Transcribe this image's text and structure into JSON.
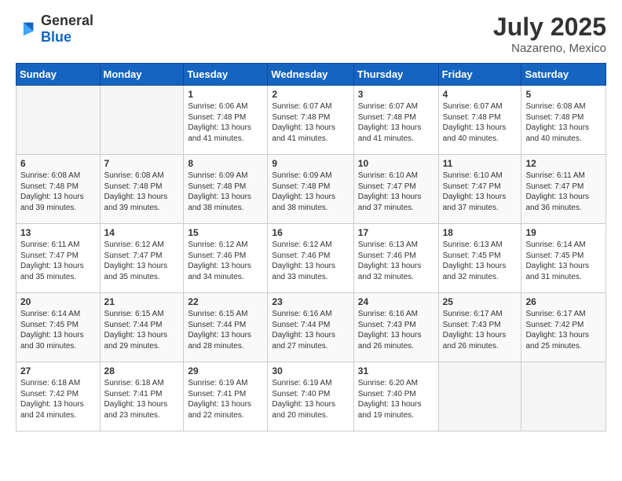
{
  "logo": {
    "general": "General",
    "blue": "Blue"
  },
  "header": {
    "month_year": "July 2025",
    "location": "Nazareno, Mexico"
  },
  "days_of_week": [
    "Sunday",
    "Monday",
    "Tuesday",
    "Wednesday",
    "Thursday",
    "Friday",
    "Saturday"
  ],
  "weeks": [
    [
      {
        "day": "",
        "info": ""
      },
      {
        "day": "",
        "info": ""
      },
      {
        "day": "1",
        "info": "Sunrise: 6:06 AM\nSunset: 7:48 PM\nDaylight: 13 hours and 41 minutes."
      },
      {
        "day": "2",
        "info": "Sunrise: 6:07 AM\nSunset: 7:48 PM\nDaylight: 13 hours and 41 minutes."
      },
      {
        "day": "3",
        "info": "Sunrise: 6:07 AM\nSunset: 7:48 PM\nDaylight: 13 hours and 41 minutes."
      },
      {
        "day": "4",
        "info": "Sunrise: 6:07 AM\nSunset: 7:48 PM\nDaylight: 13 hours and 40 minutes."
      },
      {
        "day": "5",
        "info": "Sunrise: 6:08 AM\nSunset: 7:48 PM\nDaylight: 13 hours and 40 minutes."
      }
    ],
    [
      {
        "day": "6",
        "info": "Sunrise: 6:08 AM\nSunset: 7:48 PM\nDaylight: 13 hours and 39 minutes."
      },
      {
        "day": "7",
        "info": "Sunrise: 6:08 AM\nSunset: 7:48 PM\nDaylight: 13 hours and 39 minutes."
      },
      {
        "day": "8",
        "info": "Sunrise: 6:09 AM\nSunset: 7:48 PM\nDaylight: 13 hours and 38 minutes."
      },
      {
        "day": "9",
        "info": "Sunrise: 6:09 AM\nSunset: 7:48 PM\nDaylight: 13 hours and 38 minutes."
      },
      {
        "day": "10",
        "info": "Sunrise: 6:10 AM\nSunset: 7:47 PM\nDaylight: 13 hours and 37 minutes."
      },
      {
        "day": "11",
        "info": "Sunrise: 6:10 AM\nSunset: 7:47 PM\nDaylight: 13 hours and 37 minutes."
      },
      {
        "day": "12",
        "info": "Sunrise: 6:11 AM\nSunset: 7:47 PM\nDaylight: 13 hours and 36 minutes."
      }
    ],
    [
      {
        "day": "13",
        "info": "Sunrise: 6:11 AM\nSunset: 7:47 PM\nDaylight: 13 hours and 35 minutes."
      },
      {
        "day": "14",
        "info": "Sunrise: 6:12 AM\nSunset: 7:47 PM\nDaylight: 13 hours and 35 minutes."
      },
      {
        "day": "15",
        "info": "Sunrise: 6:12 AM\nSunset: 7:46 PM\nDaylight: 13 hours and 34 minutes."
      },
      {
        "day": "16",
        "info": "Sunrise: 6:12 AM\nSunset: 7:46 PM\nDaylight: 13 hours and 33 minutes."
      },
      {
        "day": "17",
        "info": "Sunrise: 6:13 AM\nSunset: 7:46 PM\nDaylight: 13 hours and 32 minutes."
      },
      {
        "day": "18",
        "info": "Sunrise: 6:13 AM\nSunset: 7:45 PM\nDaylight: 13 hours and 32 minutes."
      },
      {
        "day": "19",
        "info": "Sunrise: 6:14 AM\nSunset: 7:45 PM\nDaylight: 13 hours and 31 minutes."
      }
    ],
    [
      {
        "day": "20",
        "info": "Sunrise: 6:14 AM\nSunset: 7:45 PM\nDaylight: 13 hours and 30 minutes."
      },
      {
        "day": "21",
        "info": "Sunrise: 6:15 AM\nSunset: 7:44 PM\nDaylight: 13 hours and 29 minutes."
      },
      {
        "day": "22",
        "info": "Sunrise: 6:15 AM\nSunset: 7:44 PM\nDaylight: 13 hours and 28 minutes."
      },
      {
        "day": "23",
        "info": "Sunrise: 6:16 AM\nSunset: 7:44 PM\nDaylight: 13 hours and 27 minutes."
      },
      {
        "day": "24",
        "info": "Sunrise: 6:16 AM\nSunset: 7:43 PM\nDaylight: 13 hours and 26 minutes."
      },
      {
        "day": "25",
        "info": "Sunrise: 6:17 AM\nSunset: 7:43 PM\nDaylight: 13 hours and 26 minutes."
      },
      {
        "day": "26",
        "info": "Sunrise: 6:17 AM\nSunset: 7:42 PM\nDaylight: 13 hours and 25 minutes."
      }
    ],
    [
      {
        "day": "27",
        "info": "Sunrise: 6:18 AM\nSunset: 7:42 PM\nDaylight: 13 hours and 24 minutes."
      },
      {
        "day": "28",
        "info": "Sunrise: 6:18 AM\nSunset: 7:41 PM\nDaylight: 13 hours and 23 minutes."
      },
      {
        "day": "29",
        "info": "Sunrise: 6:19 AM\nSunset: 7:41 PM\nDaylight: 13 hours and 22 minutes."
      },
      {
        "day": "30",
        "info": "Sunrise: 6:19 AM\nSunset: 7:40 PM\nDaylight: 13 hours and 20 minutes."
      },
      {
        "day": "31",
        "info": "Sunrise: 6:20 AM\nSunset: 7:40 PM\nDaylight: 13 hours and 19 minutes."
      },
      {
        "day": "",
        "info": ""
      },
      {
        "day": "",
        "info": ""
      }
    ]
  ]
}
